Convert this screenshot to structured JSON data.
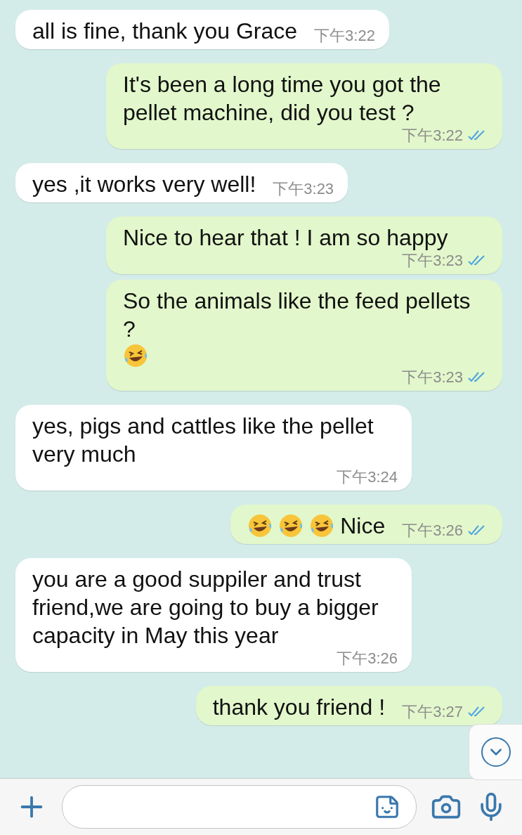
{
  "messages": [
    {
      "kind": "incoming",
      "parts": [
        {
          "kind": "text",
          "text": "all is fine, thank you Grace"
        }
      ],
      "time": "下午3:22"
    },
    {
      "kind": "outgoing",
      "parts": [
        {
          "kind": "text",
          "text": "It's been a long time you got the pellet machine, did you test ?"
        }
      ],
      "time": "下午3:22",
      "read": true
    },
    {
      "kind": "incoming",
      "parts": [
        {
          "kind": "text",
          "text": "yes ,it works very well!"
        }
      ],
      "time": "下午3:23"
    },
    {
      "kind": "outgoing",
      "parts": [
        {
          "kind": "text",
          "text": "Nice to hear that ! I am so happy"
        }
      ],
      "time": "下午3:23",
      "read": true
    },
    {
      "kind": "outgoing",
      "parts": [
        {
          "kind": "text",
          "text": "So the animals like the feed pellets ?"
        },
        {
          "kind": "emoji"
        }
      ],
      "time": "下午3:23",
      "read": true
    },
    {
      "kind": "incoming",
      "parts": [
        {
          "kind": "text",
          "text": "yes, pigs and cattles like the pellet very much"
        }
      ],
      "time": "下午3:24"
    },
    {
      "kind": "outgoing",
      "parts": [
        {
          "kind": "emoji"
        },
        {
          "kind": "emoji"
        },
        {
          "kind": "emoji"
        },
        {
          "kind": "text",
          "text": "Nice"
        }
      ],
      "time": "下午3:26",
      "read": true
    },
    {
      "kind": "incoming",
      "parts": [
        {
          "kind": "text",
          "text": "you are a good suppiler and trust friend,we are going to buy a bigger capacity in May this year"
        }
      ],
      "time": "下午3:26"
    },
    {
      "kind": "outgoing",
      "parts": [
        {
          "kind": "text",
          "text": "thank you friend !"
        }
      ],
      "time": "下午3:27",
      "read": true
    }
  ]
}
